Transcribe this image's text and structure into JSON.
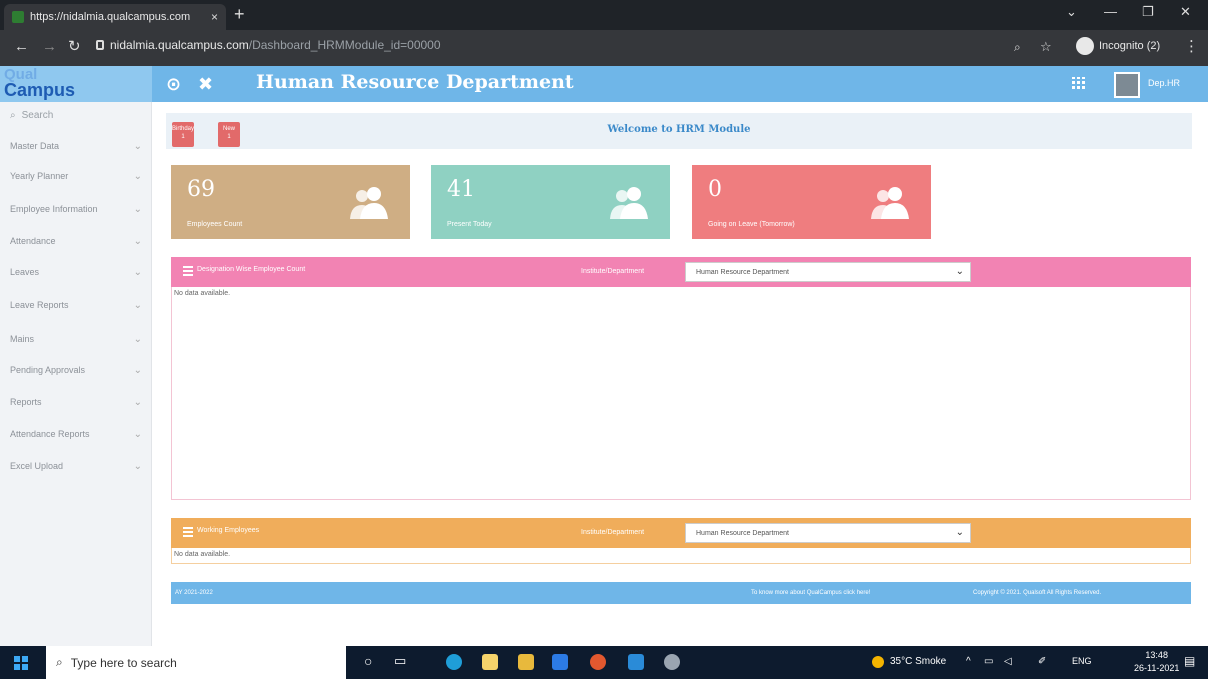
{
  "browser": {
    "tab_title": "https://nidalmia.qualcampus.com",
    "tab_close": "×",
    "new_tab": "+",
    "url_host": "nidalmia.qualcampus.com",
    "url_path": "/Dashboard_HRMModule_id=00000",
    "profile_label": "Incognito (2)"
  },
  "app": {
    "logo_top": "Qual",
    "logo_bottom": "Campus",
    "title": "Human Resource Department",
    "user_name": "Dep.HR"
  },
  "sidebar": {
    "search_placeholder": "Search",
    "items": [
      {
        "label": "Master Data"
      },
      {
        "label": "Yearly Planner"
      },
      {
        "label": "Employee Information"
      },
      {
        "label": "Attendance"
      },
      {
        "label": "Leaves"
      },
      {
        "label": "Leave Reports"
      },
      {
        "label": "Mains"
      },
      {
        "label": "Pending Approvals"
      },
      {
        "label": "Reports"
      },
      {
        "label": "Attendance Reports"
      },
      {
        "label": "Excel Upload"
      }
    ]
  },
  "welcome": {
    "btn1_label": "Birthday",
    "btn1_count": "1",
    "btn2_label": "New",
    "btn2_count": "1",
    "text": "Welcome to HRM Module"
  },
  "stats": [
    {
      "value": "69",
      "label": "Employees Count",
      "color": "#cfae84"
    },
    {
      "value": "41",
      "label": "Present Today",
      "color": "#8fd1c2"
    },
    {
      "value": "0",
      "label": "Going on Leave (Tomorrow)",
      "color": "#ef7d7f"
    }
  ],
  "panel_designation": {
    "title": "Designation Wise Employee Count",
    "filter_label": "Institute/Department",
    "filter_value": "Human Resource Department",
    "no_data": "No data available.",
    "color": "#f283b3"
  },
  "panel_working": {
    "title": "Working Employees",
    "filter_label": "Institute/Department",
    "filter_value": "Human Resource Department",
    "no_data": "No data available.",
    "color": "#f0ad5b"
  },
  "footer": {
    "year": "AY 2021-2022",
    "more": "To know more about QualCampus click here!",
    "copyright": "Copyright © 2021. Qualsoft All Rights Reserved."
  },
  "taskbar": {
    "search_placeholder": "Type here to search",
    "weather": "35°C Smoke",
    "lang": "ENG",
    "time": "13:48",
    "date": "26-11-2021"
  }
}
